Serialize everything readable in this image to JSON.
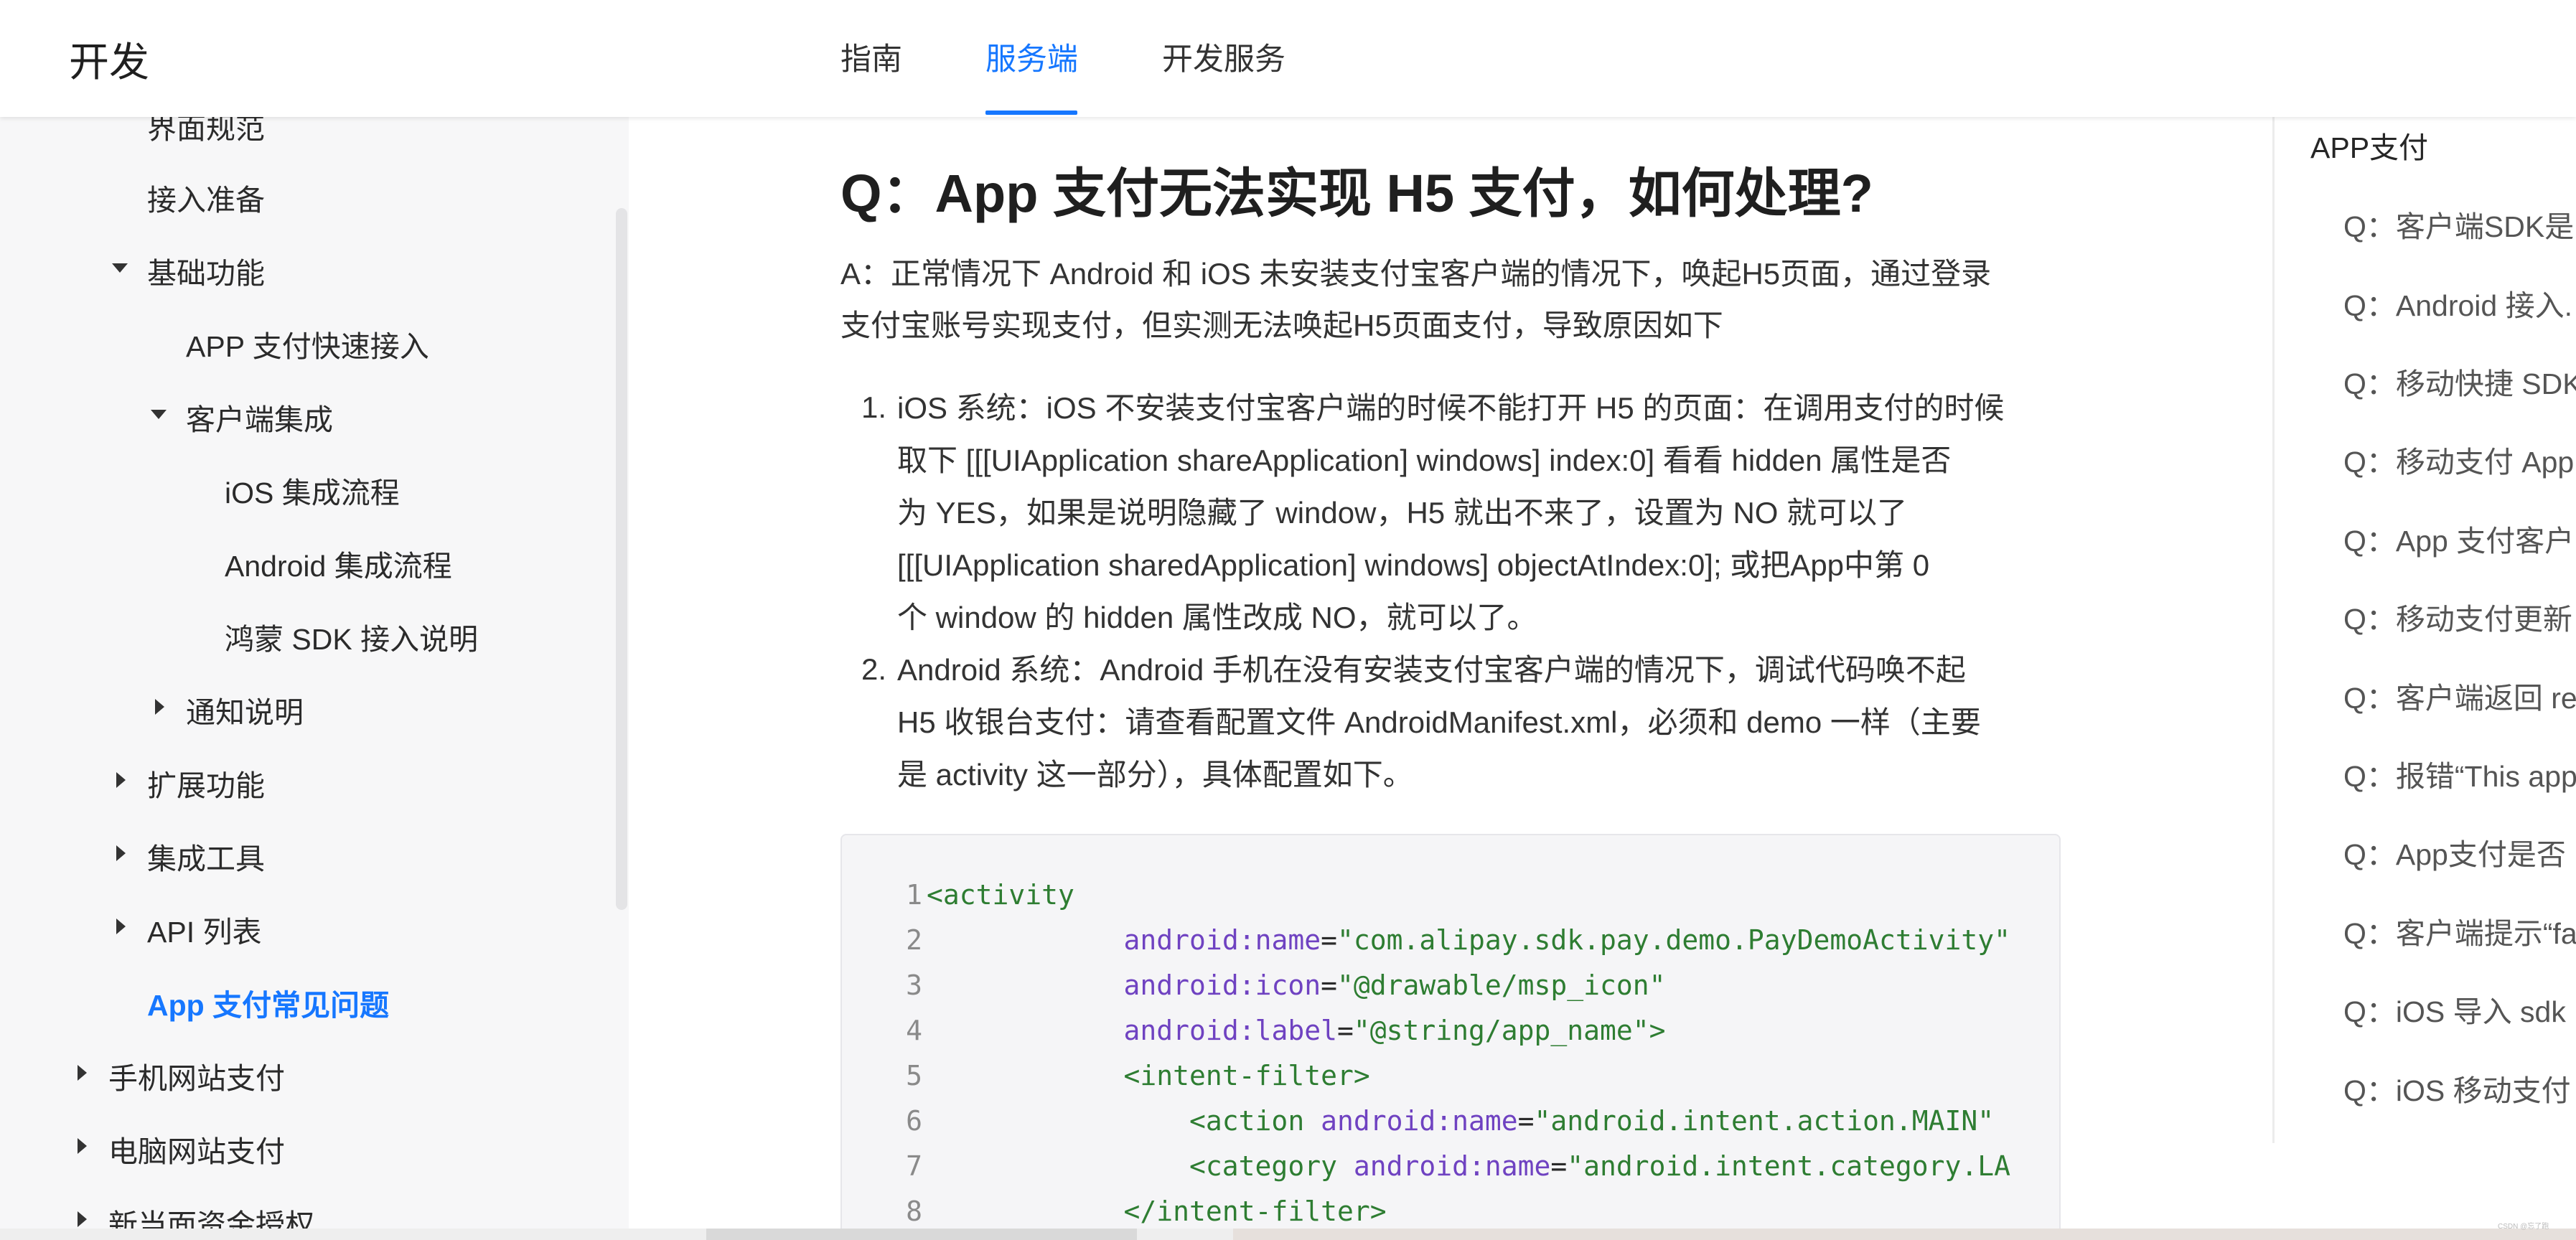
{
  "header": {
    "brand": "开发",
    "tabs": [
      {
        "label": "指南"
      },
      {
        "label": "服务端"
      },
      {
        "label": "开发服务"
      }
    ]
  },
  "sidebar": {
    "items": [
      {
        "label": "界面规范"
      },
      {
        "label": "接入准备"
      },
      {
        "label": "基础功能"
      },
      {
        "label": "APP 支付快速接入"
      },
      {
        "label": "客户端集成"
      },
      {
        "label": "iOS 集成流程"
      },
      {
        "label": "Android 集成流程"
      },
      {
        "label": "鸿蒙 SDK 接入说明"
      },
      {
        "label": "通知说明"
      },
      {
        "label": "扩展功能"
      },
      {
        "label": "集成工具"
      },
      {
        "label": "API 列表"
      },
      {
        "label": "App 支付常见问题"
      },
      {
        "label": "手机网站支付"
      },
      {
        "label": "电脑网站支付"
      },
      {
        "label": "新当面资金授权"
      }
    ]
  },
  "article": {
    "title": "Q：App 支付无法实现 H5 支付，如何处理?",
    "intro_lines": [
      "A：正常情况下 Android 和 iOS 未安装支付宝客户端的情况下，唤起H5页面，通过登录",
      "支付宝账号实现支付，但实测无法唤起H5页面支付，导致原因如下"
    ],
    "list": [
      {
        "number": "1.",
        "lines": [
          "iOS 系统：iOS 不安装支付宝客户端的时候不能打开 H5 的页面：在调用支付的时候",
          "取下 [[[UIApplication shareApplication] windows] index:0] 看看 hidden 属性是否",
          "为 YES，如果是说明隐藏了 window，H5 就出不来了，设置为 NO 就可以了",
          "[[[UIApplication sharedApplication] windows] objectAtIndex:0]; 或把App中第 0",
          "个 window 的 hidden 属性改成 NO，就可以了。"
        ]
      },
      {
        "number": "2.",
        "lines": [
          "Android 系统：Android 手机在没有安装支付宝客户端的情况下，调试代码唤不起",
          "H5 收银台支付：请查看配置文件 AndroidManifest.xml，必须和 demo 一样（主要",
          "是 activity 这一部分），具体配置如下。"
        ]
      }
    ],
    "code": [
      {
        "n": "1",
        "indent": "",
        "tag": "<activity",
        "attr": "",
        "val": "",
        "tail": ""
      },
      {
        "n": "2",
        "indent": "            ",
        "tag": "",
        "attr": "android:name",
        "val": "\"com.alipay.sdk.pay.demo.PayDemoActivity\"",
        "tail": ""
      },
      {
        "n": "3",
        "indent": "            ",
        "tag": "",
        "attr": "android:icon",
        "val": "\"@drawable/msp_icon\"",
        "tail": ""
      },
      {
        "n": "4",
        "indent": "            ",
        "tag": "",
        "attr": "android:label",
        "val": "\"@string/app_name\"",
        "tail": ">"
      },
      {
        "n": "5",
        "indent": "            ",
        "tag": "<intent-filter>",
        "attr": "",
        "val": "",
        "tail": ""
      },
      {
        "n": "6",
        "indent": "                ",
        "tag": "<action ",
        "attr": "android:name",
        "val": "\"android.intent.action.MAIN\"",
        "tail": ""
      },
      {
        "n": "7",
        "indent": "                ",
        "tag": "<category ",
        "attr": "android:name",
        "val": "\"android.intent.category.LA",
        "tail": ""
      },
      {
        "n": "8",
        "indent": "            ",
        "tag": "</intent-filter>",
        "attr": "",
        "val": "",
        "tail": ""
      }
    ]
  },
  "toc": {
    "heading": "APP支付",
    "items": [
      {
        "label": "Q：客户端SDK是"
      },
      {
        "label": "Q：Android 接入."
      },
      {
        "label": "Q：移动快捷 SDK"
      },
      {
        "label": "Q：移动支付 App"
      },
      {
        "label": "Q：App 支付客户"
      },
      {
        "label": "Q：移动支付更新"
      },
      {
        "label": "Q：客户端返回 re"
      },
      {
        "label": "Q：报错“This app"
      },
      {
        "label": "Q：App支付是否"
      },
      {
        "label": "Q：客户端提示“fa"
      },
      {
        "label": "Q：iOS 导入 sdk"
      },
      {
        "label": "Q：iOS 移动支付"
      }
    ]
  },
  "watermark": "CSDN @忘了跑",
  "colors": {
    "accent": "#1677ff"
  }
}
